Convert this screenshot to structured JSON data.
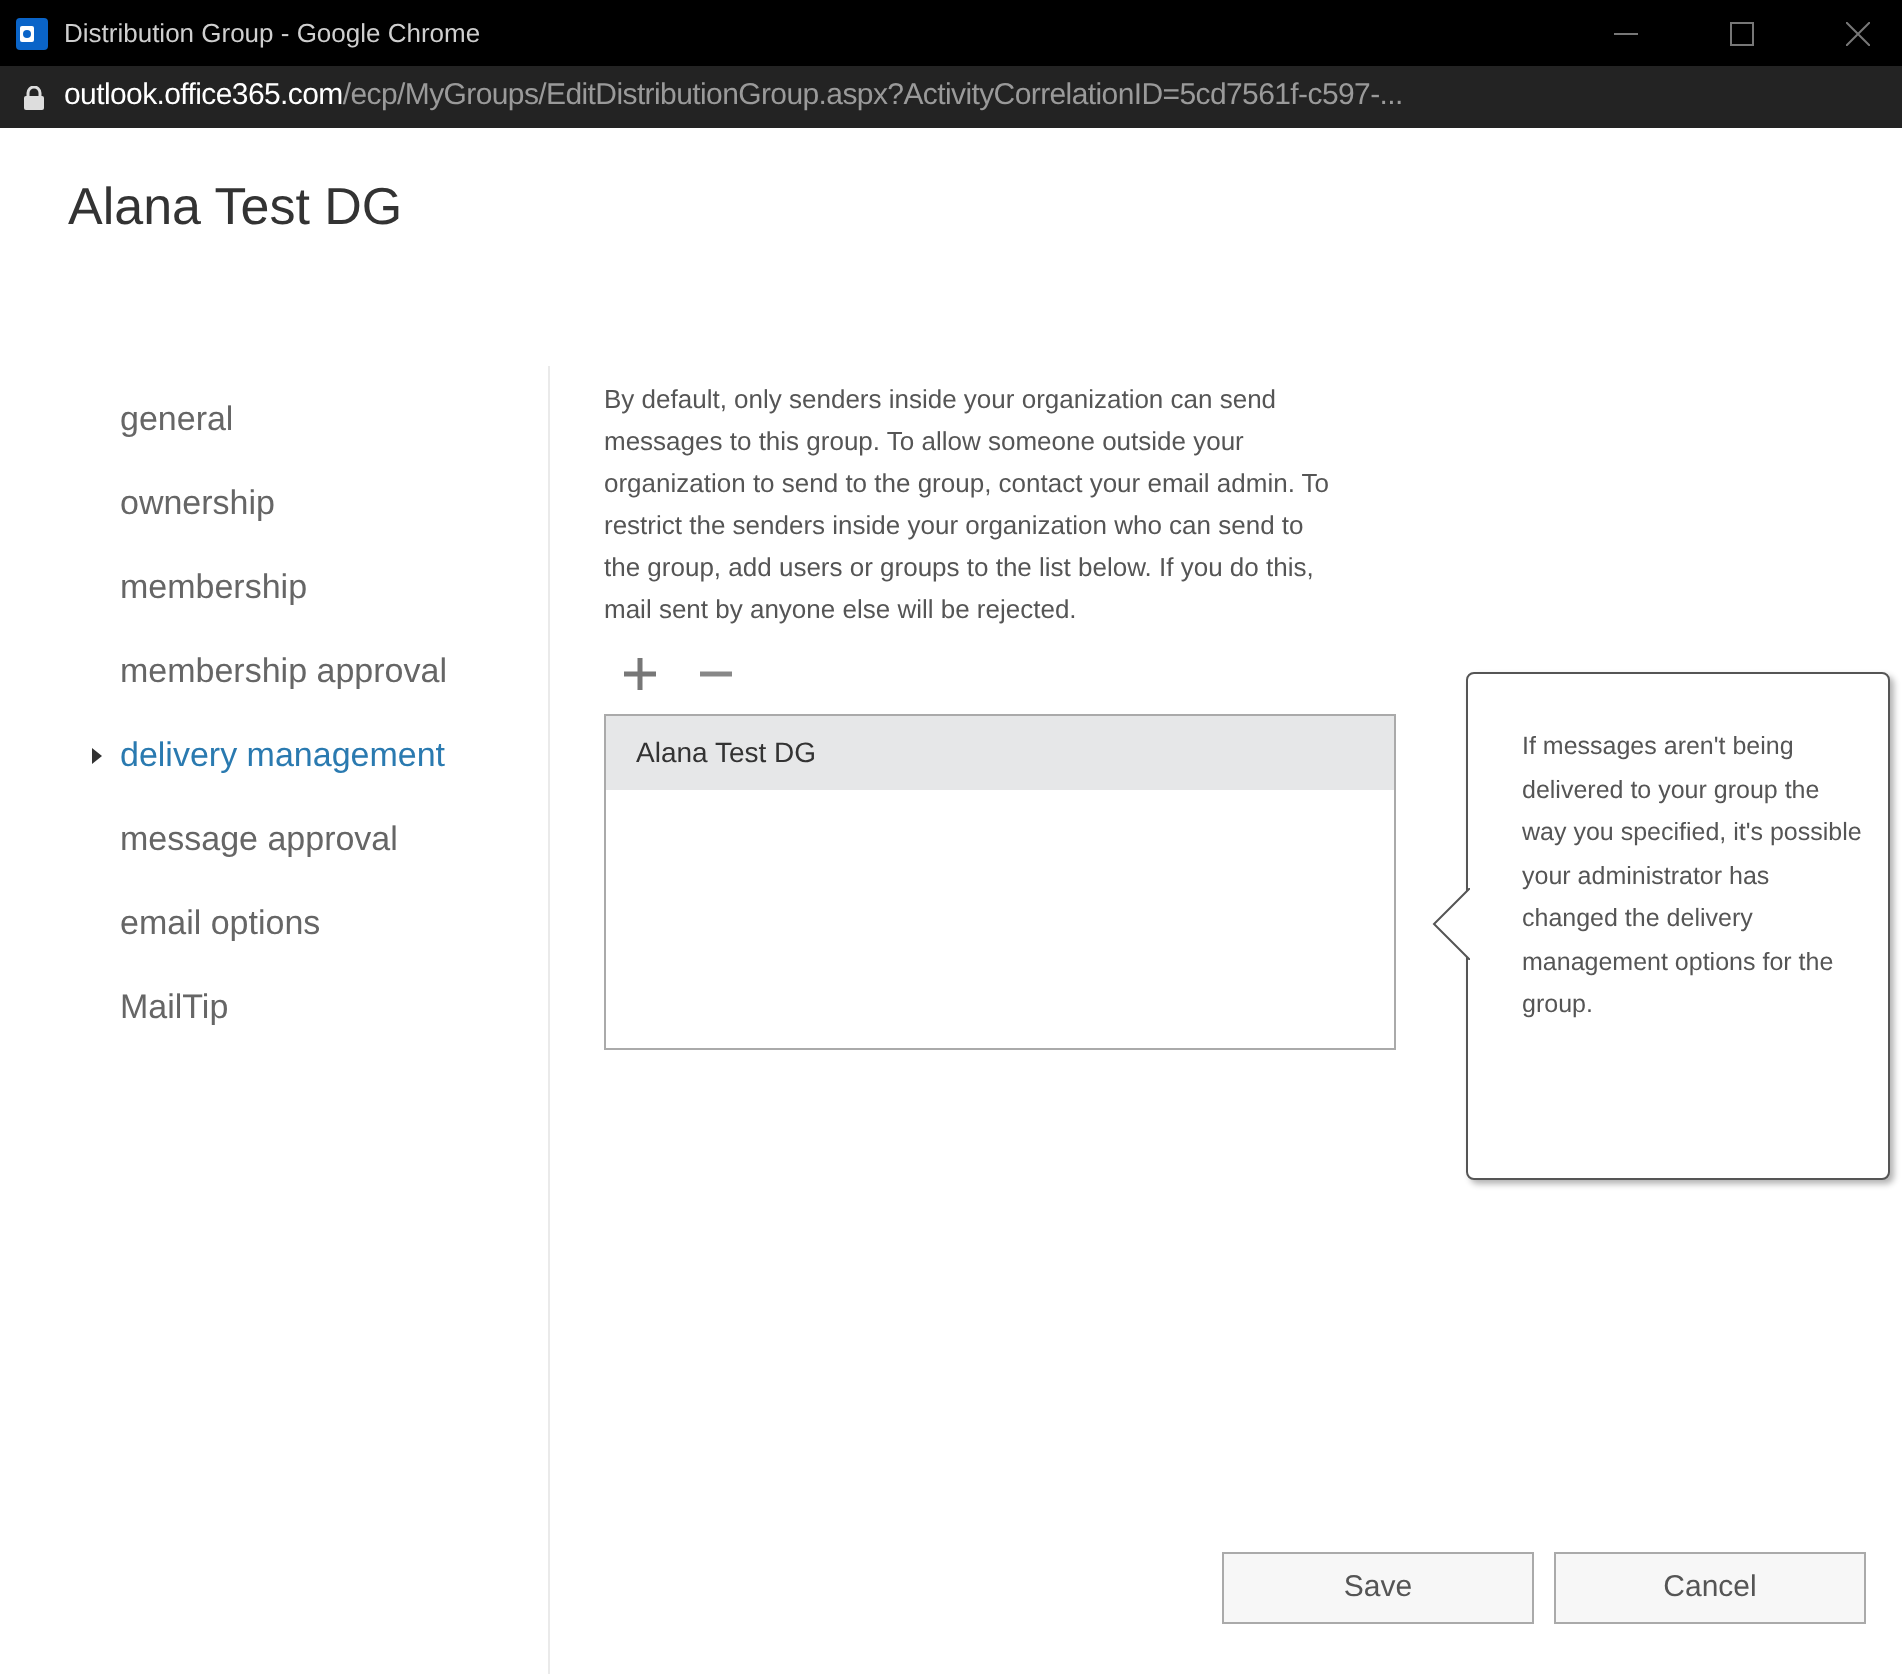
{
  "window": {
    "title": "Distribution Group - Google Chrome"
  },
  "address_bar": {
    "host": "outlook.office365.com",
    "path": "/ecp/MyGroups/EditDistributionGroup.aspx?ActivityCorrelationID=5cd7561f-c597-..."
  },
  "page_title": "Alana Test DG",
  "nav": [
    {
      "label": "general",
      "selected": false
    },
    {
      "label": "ownership",
      "selected": false
    },
    {
      "label": "membership",
      "selected": false
    },
    {
      "label": "membership approval",
      "selected": false
    },
    {
      "label": "delivery management",
      "selected": true
    },
    {
      "label": "message approval",
      "selected": false
    },
    {
      "label": "email options",
      "selected": false
    },
    {
      "label": "MailTip",
      "selected": false
    }
  ],
  "description": "By default, only senders inside your organization can send messages to this group. To allow someone outside your organization to send to the group, contact your email admin. To restrict the senders inside your organization who can send to the group, add users or groups to the list below. If you do this, mail sent by anyone else will be rejected.",
  "senders": [
    {
      "name": "Alana Test DG",
      "selected": true
    }
  ],
  "callout": "If messages aren't being delivered to your group the way you specified, it's possible your administrator has changed the delivery management options for the group.",
  "buttons": [
    {
      "label": "Save"
    },
    {
      "label": "Cancel"
    }
  ]
}
